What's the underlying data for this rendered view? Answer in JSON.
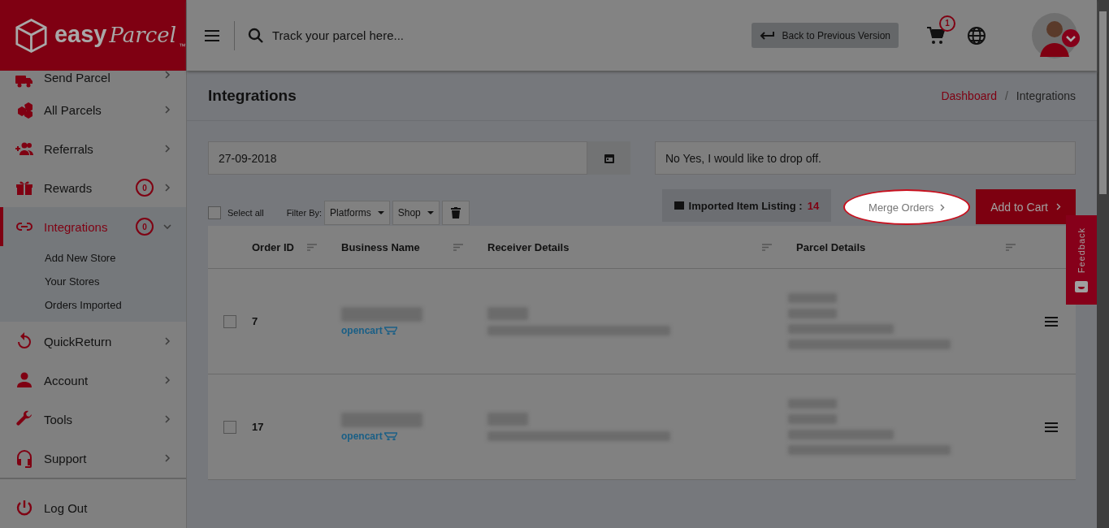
{
  "header": {
    "logo": {
      "word": "easy",
      "script": "Parcel",
      "mark": "™"
    },
    "search": {
      "placeholder": "Track your parcel here..."
    },
    "back_button": "Back to Previous Version",
    "cart_count": "1"
  },
  "sidebar": {
    "items": [
      {
        "label": "Send Parcel",
        "selected": false,
        "expanded": false
      },
      {
        "label": "All Parcels",
        "selected": false,
        "expanded": false
      },
      {
        "label": "Referrals",
        "selected": false,
        "expanded": false
      },
      {
        "label": "Rewards",
        "badge": "0",
        "selected": false,
        "expanded": false
      },
      {
        "label": "Integrations",
        "badge": "0",
        "selected": true,
        "expanded": true,
        "children": [
          {
            "label": "Add New Store"
          },
          {
            "label": "Your Stores"
          },
          {
            "label": "Orders Imported"
          }
        ]
      },
      {
        "label": "QuickReturn",
        "selected": false,
        "expanded": false
      },
      {
        "label": "Account",
        "selected": false,
        "expanded": false
      },
      {
        "label": "Tools",
        "selected": false,
        "expanded": false
      },
      {
        "label": "Support",
        "selected": false,
        "expanded": false
      }
    ],
    "logout": "Log Out"
  },
  "page_title": "Integrations",
  "breadcrumbs": [
    {
      "label": "Dashboard",
      "kind": "link"
    },
    {
      "label": "/",
      "kind": "separator"
    },
    {
      "label": "Integrations",
      "kind": "current"
    }
  ],
  "date_field": {
    "value": "27-09-2018"
  },
  "dropoff_field": {
    "value": "No Yes, I would like to drop off."
  },
  "toolbar": {
    "select_all": {
      "label": "Select all",
      "checked": false
    },
    "filter_label": "Filter By:",
    "dropdowns": [
      "Platforms",
      "Shop"
    ],
    "imported_label": "Imported Item Listing :",
    "imported_count": "14",
    "merge_button": {
      "label": "Merge Orders",
      "highlighted": true
    },
    "add_to_cart": "Add to Cart"
  },
  "table": {
    "columns": [
      "Order ID",
      "Business Name",
      "Receiver Details",
      "Parcel Details"
    ],
    "rows": [
      {
        "order_id": "7",
        "checked": false,
        "platform": "opencart"
      },
      {
        "order_id": "17",
        "checked": false,
        "platform": "opencart"
      }
    ]
  },
  "feedback": "Feedback"
}
